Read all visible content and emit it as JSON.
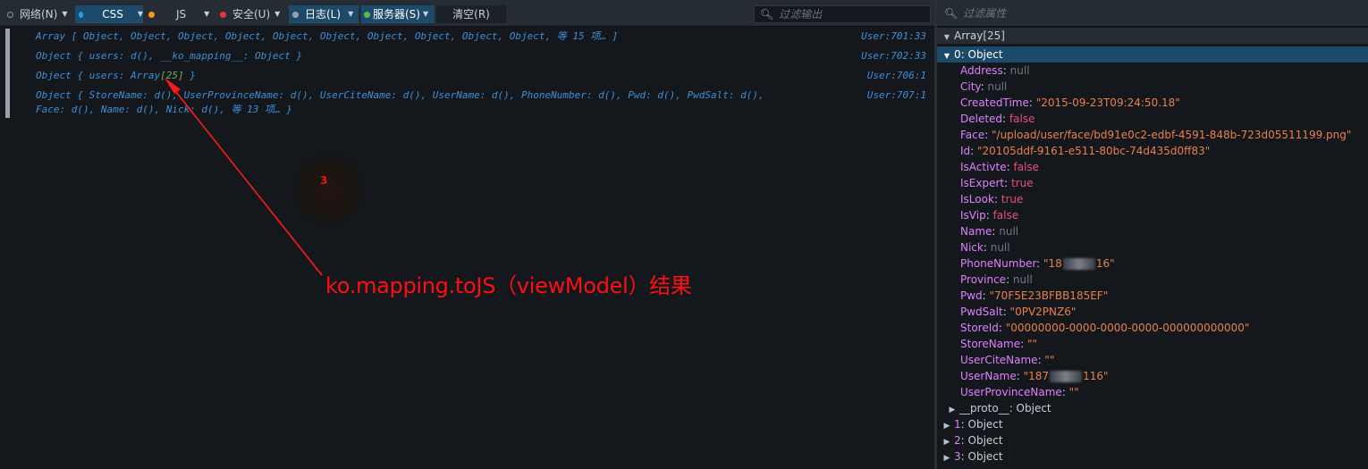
{
  "toolbar": {
    "tabs": [
      {
        "label": "网络(N)",
        "dot_color": "#8a929a",
        "selected": false
      },
      {
        "label": "CSS",
        "dot_color": "#23a0e6",
        "selected": true
      },
      {
        "label": "JS",
        "dot_color": "#f29a1a",
        "selected": false
      },
      {
        "label": "安全(U)",
        "dot_color": "#e5383b",
        "selected": false
      },
      {
        "label": "日志(L)",
        "dot_color": "#9aa3ac",
        "selected": true
      },
      {
        "label": "服务器(S)",
        "dot_color": "#5aba4a",
        "selected": true
      }
    ],
    "clear_label": "清空(R)",
    "filter_placeholder": "过滤输出"
  },
  "console": {
    "lines": [
      {
        "pre": "Array [ Object, Object, Object, Object, Object, Object, Object, Object, Object, Object, 等 15 项… ]",
        "source": "User:701:33"
      },
      {
        "pre": "Object { users: d(), __ko_mapping__: Object }",
        "source": "User:702:33"
      },
      {
        "pre": "Object { users: Array",
        "num": "[25]",
        "post": " }",
        "source": "User:706:1"
      },
      {
        "pre": "Object { StoreName: d(), UserProvinceName: d(), UserCiteName: d(), UserName: d(), PhoneNumber: d(), Pwd: d(), PwdSalt: d(),",
        "pre2": "Face: d(), Name: d(), Nick: d(), 等 13 项… }",
        "source": "User:707:1"
      }
    ]
  },
  "annotation": {
    "number": "3",
    "text": "ko.mapping.toJS（viewModel）结果",
    "color": "#ff0f0f"
  },
  "props": {
    "filter_placeholder": "过滤属性",
    "root_label": "Array[25]",
    "selected_label": "0: Object",
    "items": [
      {
        "key": "Address",
        "value": "null",
        "type": "null"
      },
      {
        "key": "City",
        "value": "null",
        "type": "null"
      },
      {
        "key": "CreatedTime",
        "value": "\"2015-09-23T09:24:50.18\"",
        "type": "str"
      },
      {
        "key": "Deleted",
        "value": "false",
        "type": "bool"
      },
      {
        "key": "Face",
        "value": "\"/upload/user/face/bd91e0c2-edbf-4591-848b-723d05511199.png\"",
        "type": "str"
      },
      {
        "key": "Id",
        "value": "\"20105ddf-9161-e511-80bc-74d435d0ff83\"",
        "type": "str"
      },
      {
        "key": "IsActivte",
        "value": "false",
        "type": "bool"
      },
      {
        "key": "IsExpert",
        "value": "true",
        "type": "bool"
      },
      {
        "key": "IsLook",
        "value": "true",
        "type": "bool"
      },
      {
        "key": "IsVip",
        "value": "false",
        "type": "bool"
      },
      {
        "key": "Name",
        "value": "null",
        "type": "null"
      },
      {
        "key": "Nick",
        "value": "null",
        "type": "null"
      },
      {
        "key": "PhoneNumber",
        "value_pre": "\"18",
        "value_post": "16\"",
        "type": "redacted"
      },
      {
        "key": "Province",
        "value": "null",
        "type": "null"
      },
      {
        "key": "Pwd",
        "value": "\"70F5E23BFBB185EF\"",
        "type": "str"
      },
      {
        "key": "PwdSalt",
        "value": "\"0PV2PNZ6\"",
        "type": "str"
      },
      {
        "key": "StoreId",
        "value": "\"00000000-0000-0000-0000-000000000000\"",
        "type": "str"
      },
      {
        "key": "StoreName",
        "value": "\"\"",
        "type": "str"
      },
      {
        "key": "UserCiteName",
        "value": "\"\"",
        "type": "str"
      },
      {
        "key": "UserName",
        "value_pre": "\"187",
        "value_post": "116\"",
        "type": "redacted"
      },
      {
        "key": "UserProvinceName",
        "value": "\"\"",
        "type": "str"
      }
    ],
    "proto": {
      "key": "__proto__",
      "value": "Object"
    },
    "siblings": [
      {
        "key": "1",
        "value": "Object"
      },
      {
        "key": "2",
        "value": "Object"
      },
      {
        "key": "3",
        "value": "Object"
      }
    ]
  }
}
